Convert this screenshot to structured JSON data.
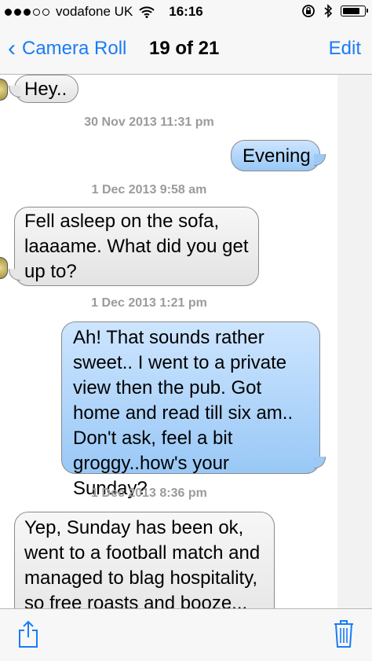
{
  "status_bar": {
    "carrier": "vodafone UK",
    "time": "16:16",
    "battery_level": 0.85
  },
  "nav": {
    "back_label": "Camera Roll",
    "title": "19 of 21",
    "edit_label": "Edit"
  },
  "messages": [
    {
      "kind": "in",
      "text": "Hey.."
    },
    {
      "kind": "timestamp",
      "text": "30 Nov 2013 11:31 pm"
    },
    {
      "kind": "out",
      "text": "Evening"
    },
    {
      "kind": "timestamp",
      "text": "1 Dec 2013 9:58 am"
    },
    {
      "kind": "in",
      "text": "Fell asleep on the sofa, laaaame. What did you get up to?"
    },
    {
      "kind": "timestamp",
      "text": "1 Dec 2013 1:21 pm"
    },
    {
      "kind": "out",
      "text": "Ah! That sounds rather sweet.. I went to a private view then the pub. Got home and read till six am.. Don't ask, feel a bit groggy..how's your Sunday?"
    },
    {
      "kind": "timestamp",
      "text": "1 Dec 2013 8:36 pm"
    },
    {
      "kind": "in",
      "text": "Yep, Sunday has been ok, went to a football match and managed to blag hospitality, so free roasts and booze..."
    }
  ],
  "toolbar": {
    "share_icon": "share-icon",
    "trash_icon": "trash-icon"
  }
}
